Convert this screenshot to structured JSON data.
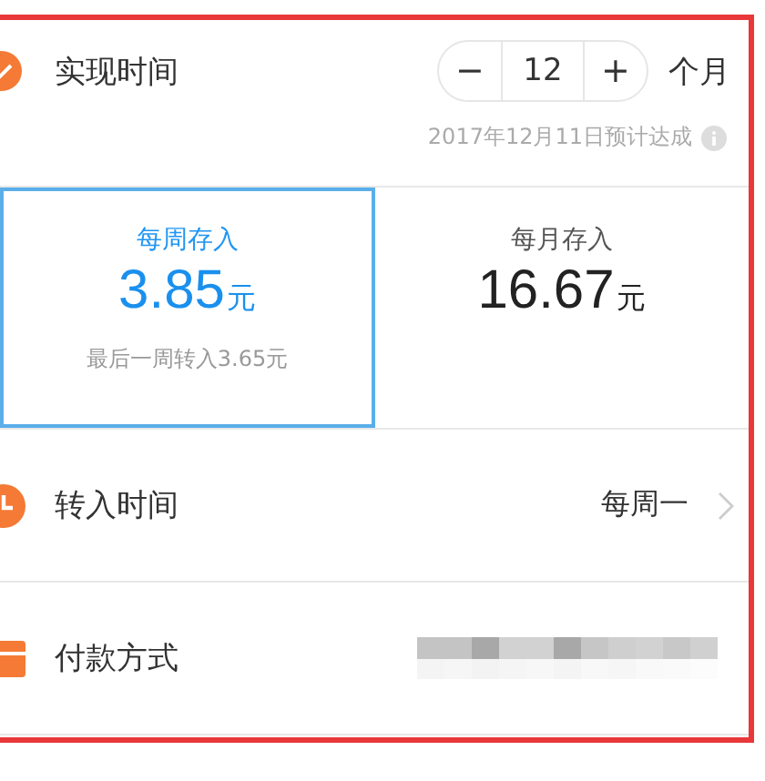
{
  "goal_time": {
    "label": "实现时间",
    "checked": true,
    "stepper": {
      "minus": "−",
      "value": "12",
      "plus": "+"
    },
    "unit": "个月",
    "note": "2017年12月11日预计达成"
  },
  "deposit_options": [
    {
      "title": "每周存入",
      "amount": "3.85",
      "currency": "元",
      "note": "最后一周转入3.65元",
      "selected": true
    },
    {
      "title": "每月存入",
      "amount": "16.67",
      "currency": "元",
      "selected": false
    }
  ],
  "rows": [
    {
      "kind": "time",
      "label": "转入时间",
      "value": "每周一"
    },
    {
      "kind": "payment",
      "label": "付款方式"
    }
  ]
}
